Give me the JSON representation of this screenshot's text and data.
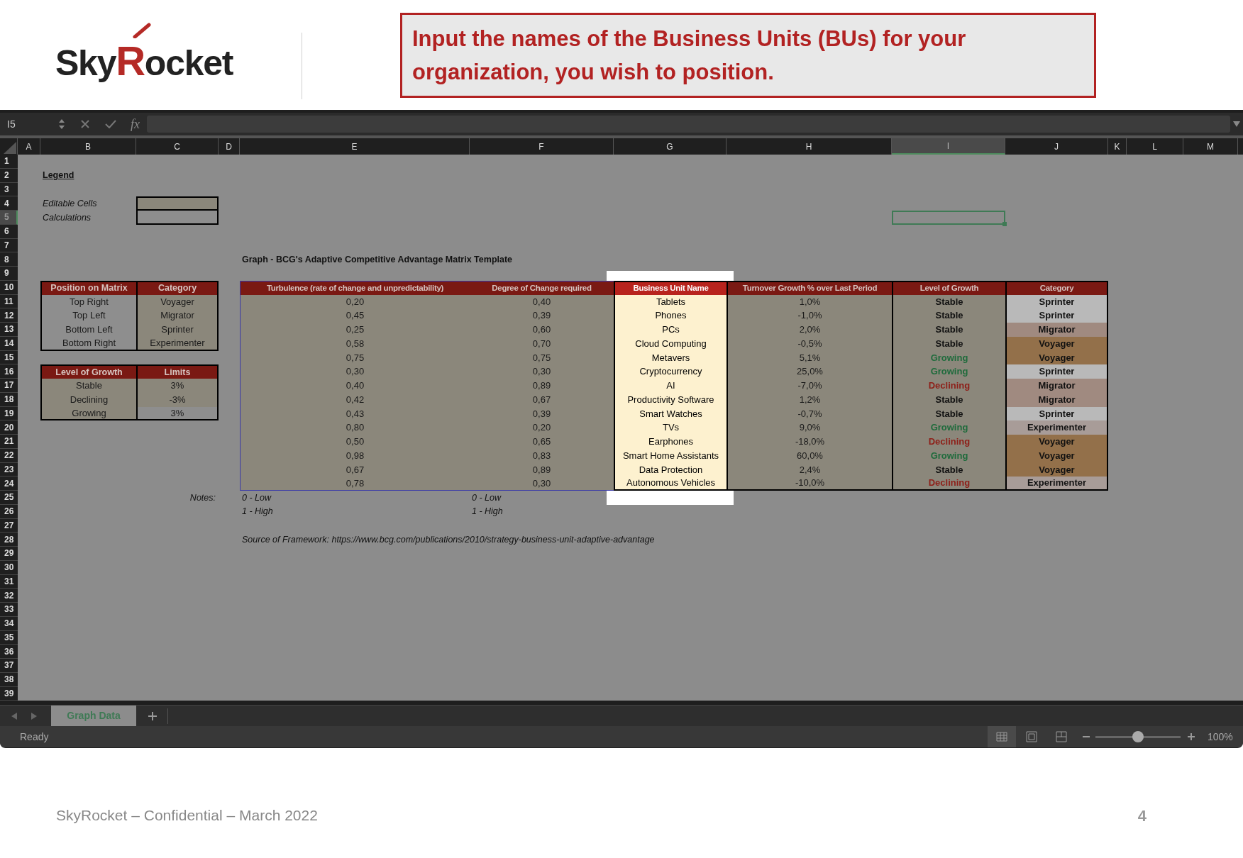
{
  "logo": {
    "parts": [
      {
        "text": "Sky",
        "accent": false
      },
      {
        "text": "R",
        "accent": true
      },
      {
        "text": "ocket",
        "accent": false
      }
    ]
  },
  "callout": "Input the names of the Business Units (BUs) for your organization, you wish to position.",
  "formula_bar": {
    "name_box": "I5",
    "fx": "fx"
  },
  "columns": [
    {
      "label": "A",
      "selected": false
    },
    {
      "label": "B",
      "selected": false
    },
    {
      "label": "C",
      "selected": false
    },
    {
      "label": "D",
      "selected": false
    },
    {
      "label": "E",
      "selected": false
    },
    {
      "label": "F",
      "selected": false
    },
    {
      "label": "G",
      "selected": false
    },
    {
      "label": "H",
      "selected": false
    },
    {
      "label": "I",
      "selected": true
    },
    {
      "label": "J",
      "selected": false
    },
    {
      "label": "K",
      "selected": false
    },
    {
      "label": "L",
      "selected": false
    },
    {
      "label": "M",
      "selected": false
    }
  ],
  "rows": [
    {
      "label": "1",
      "selected": false
    },
    {
      "label": "2",
      "selected": false
    },
    {
      "label": "3",
      "selected": false
    },
    {
      "label": "4",
      "selected": false
    },
    {
      "label": "5",
      "selected": true
    },
    {
      "label": "6",
      "selected": false
    },
    {
      "label": "7",
      "selected": false
    },
    {
      "label": "8",
      "selected": false
    },
    {
      "label": "9",
      "selected": false
    },
    {
      "label": "10",
      "selected": false
    },
    {
      "label": "11",
      "selected": false
    },
    {
      "label": "12",
      "selected": false
    },
    {
      "label": "13",
      "selected": false
    },
    {
      "label": "14",
      "selected": false
    },
    {
      "label": "15",
      "selected": false
    },
    {
      "label": "16",
      "selected": false
    },
    {
      "label": "17",
      "selected": false
    },
    {
      "label": "18",
      "selected": false
    },
    {
      "label": "19",
      "selected": false
    },
    {
      "label": "20",
      "selected": false
    },
    {
      "label": "21",
      "selected": false
    },
    {
      "label": "22",
      "selected": false
    },
    {
      "label": "23",
      "selected": false
    },
    {
      "label": "24",
      "selected": false
    },
    {
      "label": "25",
      "selected": false
    },
    {
      "label": "26",
      "selected": false
    },
    {
      "label": "27",
      "selected": false
    },
    {
      "label": "28",
      "selected": false
    },
    {
      "label": "29",
      "selected": false
    },
    {
      "label": "30",
      "selected": false
    },
    {
      "label": "31",
      "selected": false
    },
    {
      "label": "32",
      "selected": false
    },
    {
      "label": "33",
      "selected": false
    },
    {
      "label": "34",
      "selected": false
    },
    {
      "label": "35",
      "selected": false
    },
    {
      "label": "36",
      "selected": false
    },
    {
      "label": "37",
      "selected": false
    },
    {
      "label": "38",
      "selected": false
    },
    {
      "label": "39",
      "selected": false
    }
  ],
  "legend": {
    "title": "Legend",
    "items": [
      {
        "label": "Editable Cells",
        "color": "#8b877b"
      },
      {
        "label": "Calculations",
        "color": "#8e8e8e"
      }
    ]
  },
  "graph_title": "Graph - BCG's Adaptive Competitive Advantage Matrix Template",
  "position_table": {
    "columns": [
      "Position on Matrix",
      "Category"
    ],
    "rows": [
      [
        {
          "text": "Top Right",
          "editable": false
        },
        {
          "text": "Voyager",
          "editable": true
        }
      ],
      [
        {
          "text": "Top Left",
          "editable": false
        },
        {
          "text": "Migrator",
          "editable": true
        }
      ],
      [
        {
          "text": "Bottom Left",
          "editable": false
        },
        {
          "text": "Sprinter",
          "editable": true
        }
      ],
      [
        {
          "text": "Bottom Right",
          "editable": false
        },
        {
          "text": "Experimenter",
          "editable": true
        }
      ]
    ]
  },
  "growth_table": {
    "columns": [
      "Level of Growth",
      "Limits"
    ],
    "rows": [
      [
        {
          "text": "Stable",
          "editable": true
        },
        {
          "text": "3%",
          "editable": true
        }
      ],
      [
        {
          "text": "Declining",
          "editable": true
        },
        {
          "text": "-3%",
          "editable": true
        }
      ],
      [
        {
          "text": "Growing",
          "editable": true
        },
        {
          "text": "3%",
          "editable": false
        }
      ]
    ]
  },
  "main_table": {
    "columns": [
      {
        "label": "Turbulence (rate of change and unpredictability)",
        "kind": "editable"
      },
      {
        "label": "Degree of Change required",
        "kind": "editable"
      },
      {
        "label": "Business Unit Name",
        "kind": "input"
      },
      {
        "label": "Turnover Growth % over Last Period",
        "kind": "editable"
      },
      {
        "label": "Level of Growth",
        "kind": "growth"
      },
      {
        "label": "Category",
        "kind": "category"
      }
    ],
    "rows": [
      {
        "turbulence": "0,20",
        "change": "0,40",
        "name": "Tablets",
        "growth": "1,0%",
        "level": {
          "text": "Stable",
          "color": "#111111"
        },
        "category": "Sprinter",
        "color": "#b9b9b9"
      },
      {
        "turbulence": "0,45",
        "change": "0,39",
        "name": "Phones",
        "growth": "-1,0%",
        "level": {
          "text": "Stable",
          "color": "#111111"
        },
        "category": "Sprinter",
        "color": "#b9b9b9"
      },
      {
        "turbulence": "0,25",
        "change": "0,60",
        "name": "PCs",
        "growth": "2,0%",
        "level": {
          "text": "Stable",
          "color": "#111111"
        },
        "category": "Migrator",
        "color": "#a08a80"
      },
      {
        "turbulence": "0,58",
        "change": "0,70",
        "name": "Cloud Computing",
        "growth": "-0,5%",
        "level": {
          "text": "Stable",
          "color": "#111111"
        },
        "category": "Voyager",
        "color": "#93704a"
      },
      {
        "turbulence": "0,75",
        "change": "0,75",
        "name": "Metavers",
        "growth": "5,1%",
        "level": {
          "text": "Growing",
          "color": "#1f6b3c"
        },
        "category": "Voyager",
        "color": "#93704a"
      },
      {
        "turbulence": "0,30",
        "change": "0,30",
        "name": "Cryptocurrency",
        "growth": "25,0%",
        "level": {
          "text": "Growing",
          "color": "#1f6b3c"
        },
        "category": "Sprinter",
        "color": "#b9b9b9"
      },
      {
        "turbulence": "0,40",
        "change": "0,89",
        "name": "AI",
        "growth": "-7,0%",
        "level": {
          "text": "Declining",
          "color": "#8e1f18"
        },
        "category": "Migrator",
        "color": "#a08a80"
      },
      {
        "turbulence": "0,42",
        "change": "0,67",
        "name": "Productivity Software",
        "growth": "1,2%",
        "level": {
          "text": "Stable",
          "color": "#111111"
        },
        "category": "Migrator",
        "color": "#a08a80"
      },
      {
        "turbulence": "0,43",
        "change": "0,39",
        "name": "Smart Watches",
        "growth": "-0,7%",
        "level": {
          "text": "Stable",
          "color": "#111111"
        },
        "category": "Sprinter",
        "color": "#b9b9b9"
      },
      {
        "turbulence": "0,80",
        "change": "0,20",
        "name": "TVs",
        "growth": "9,0%",
        "level": {
          "text": "Growing",
          "color": "#1f6b3c"
        },
        "category": "Experimenter",
        "color": "#a89c98"
      },
      {
        "turbulence": "0,50",
        "change": "0,65",
        "name": "Earphones",
        "growth": "-18,0%",
        "level": {
          "text": "Declining",
          "color": "#8e1f18"
        },
        "category": "Voyager",
        "color": "#93704a"
      },
      {
        "turbulence": "0,98",
        "change": "0,83",
        "name": "Smart Home Assistants",
        "growth": "60,0%",
        "level": {
          "text": "Growing",
          "color": "#1f6b3c"
        },
        "category": "Voyager",
        "color": "#93704a"
      },
      {
        "turbulence": "0,67",
        "change": "0,89",
        "name": "Data Protection",
        "growth": "2,4%",
        "level": {
          "text": "Stable",
          "color": "#111111"
        },
        "category": "Voyager",
        "color": "#93704a"
      },
      {
        "turbulence": "0,78",
        "change": "0,30",
        "name": "Autonomous Vehicles",
        "growth": "-10,0%",
        "level": {
          "text": "Declining",
          "color": "#8e1f18"
        },
        "category": "Experimenter",
        "color": "#a89c98"
      }
    ]
  },
  "notes": {
    "label": "Notes:",
    "columns": [
      [
        "0 - Low",
        "1 - High"
      ],
      [
        "0 - Low",
        "1 - High"
      ]
    ]
  },
  "source": "Source of Framework: https://www.bcg.com/publications/2010/strategy-business-unit-adaptive-advantage",
  "sheet_tabs": [
    {
      "label": "Graph Data",
      "selected": true
    }
  ],
  "status_bar": {
    "text": "Ready",
    "zoom": "100%",
    "zoom_slider": {
      "level": 0.5
    }
  },
  "footer": {
    "text": "SkyRocket – Confidential – March 2022",
    "page": "4"
  }
}
